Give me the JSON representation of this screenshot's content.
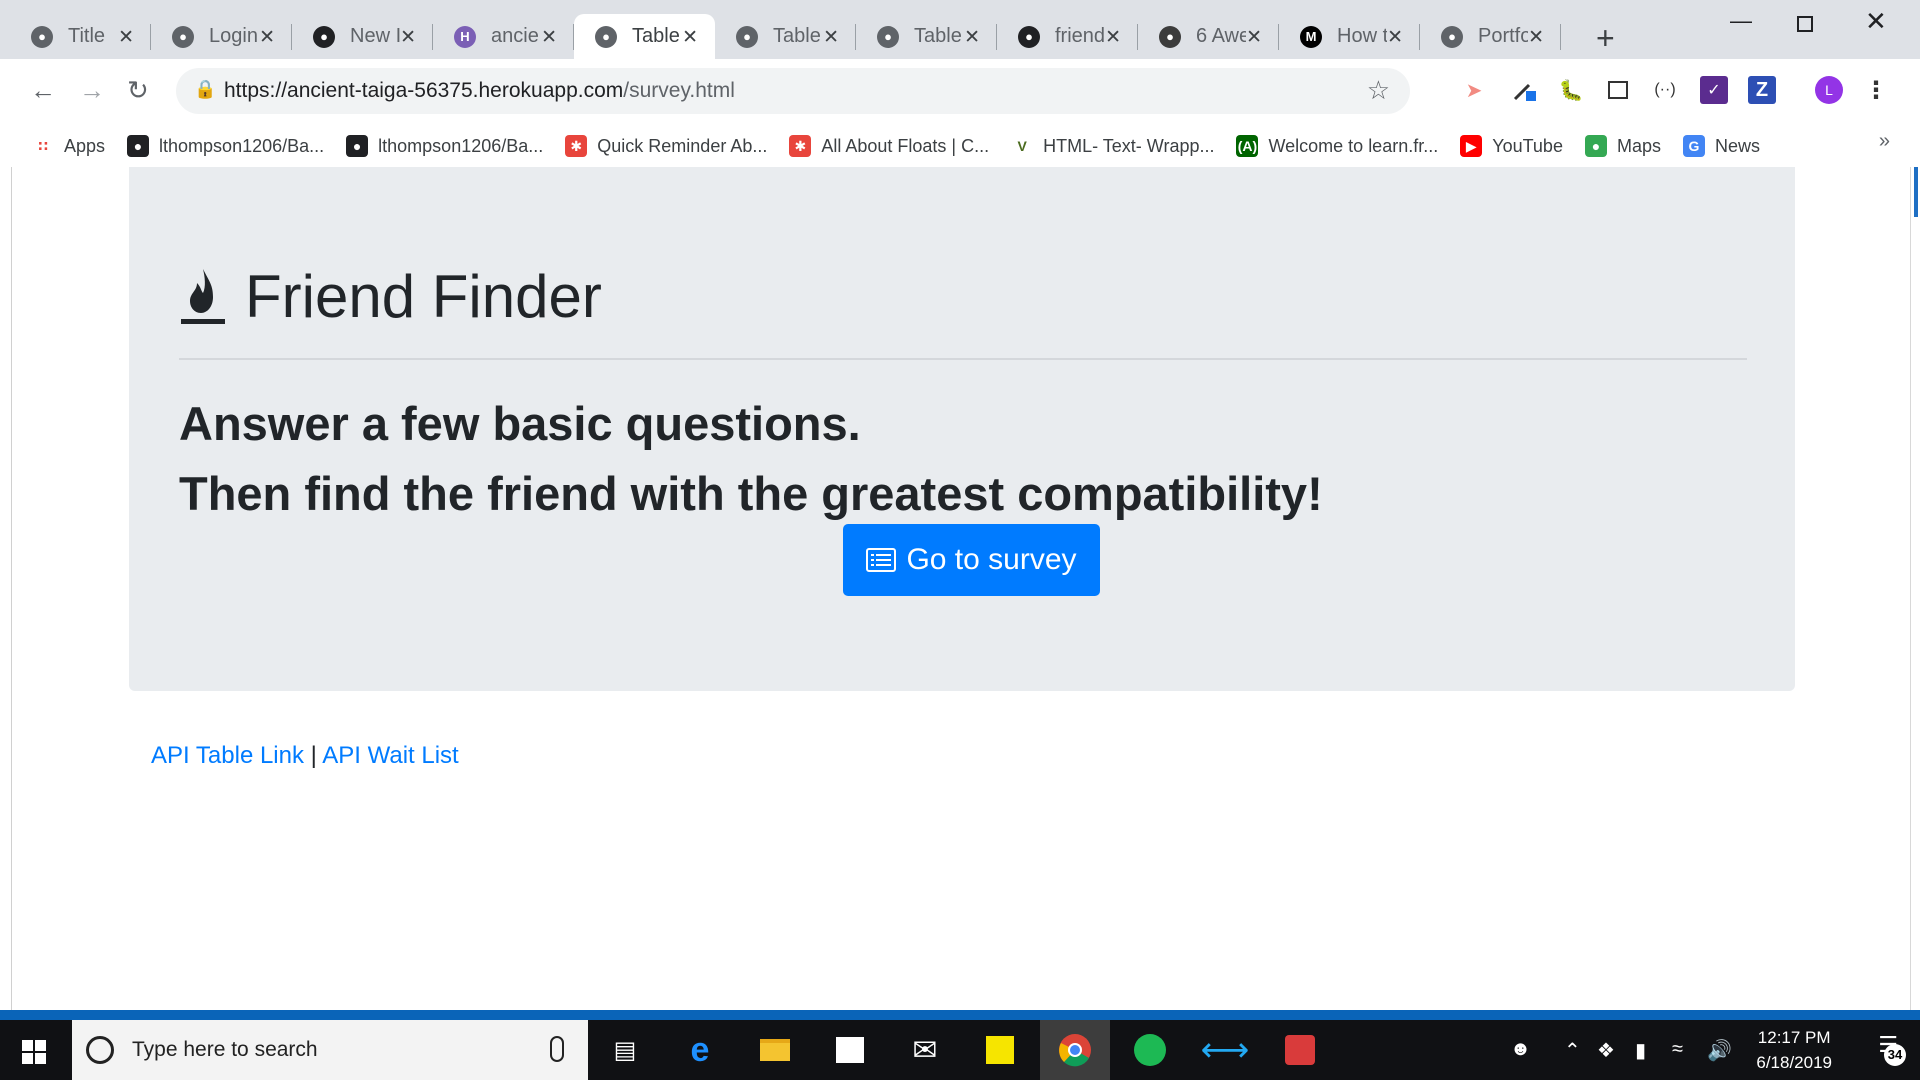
{
  "browser": {
    "tabs": [
      {
        "title": "Title",
        "icon": "globe-icon",
        "active": false
      },
      {
        "title": "Login",
        "icon": "globe-icon",
        "active": false
      },
      {
        "title": "New I",
        "icon": "github-icon",
        "active": false
      },
      {
        "title": "ancie",
        "icon": "heroku-icon",
        "active": false
      },
      {
        "title": "Table",
        "icon": "globe-icon",
        "active": true
      },
      {
        "title": "Table",
        "icon": "globe-icon",
        "active": false
      },
      {
        "title": "Table",
        "icon": "globe-icon",
        "active": false
      },
      {
        "title": "friend",
        "icon": "github-icon",
        "active": false
      },
      {
        "title": "6 Awe",
        "icon": "owl-icon",
        "active": false
      },
      {
        "title": "How t",
        "icon": "medium-icon",
        "active": false
      },
      {
        "title": "Portfo",
        "icon": "globe-icon",
        "active": false
      }
    ],
    "url_host": "https://ancient-taiga-56375.herokuapp.com",
    "url_path": "/survey.html",
    "profile_initial": "L",
    "bookmarks": [
      {
        "label": "Apps",
        "icon": "apps-grid-icon"
      },
      {
        "label": "lthompson1206/Ba...",
        "icon": "github-icon"
      },
      {
        "label": "lthompson1206/Ba...",
        "icon": "github-icon"
      },
      {
        "label": "Quick Reminder Ab...",
        "icon": "asterisk-icon"
      },
      {
        "label": "All About Floats | C...",
        "icon": "asterisk-icon"
      },
      {
        "label": "HTML- Text- Wrapp...",
        "icon": "v-icon"
      },
      {
        "label": "Welcome to learn.fr...",
        "icon": "freecodecamp-icon"
      },
      {
        "label": "YouTube",
        "icon": "youtube-icon"
      },
      {
        "label": "Maps",
        "icon": "maps-icon"
      },
      {
        "label": "News",
        "icon": "news-icon"
      }
    ]
  },
  "page": {
    "brand": "Friend Finder",
    "lead_line1": "Answer a few basic questions.",
    "lead_line2": "Then find the friend with the greatest compatibility!",
    "survey_button": "Go to survey",
    "link_api_table": "API Table Link",
    "link_separator": "|",
    "link_api_waitlist": "API Wait List",
    "accent_color": "#007bff"
  },
  "taskbar": {
    "search_placeholder": "Type here to search",
    "time": "12:17 PM",
    "date": "6/18/2019",
    "notification_count": "34"
  }
}
